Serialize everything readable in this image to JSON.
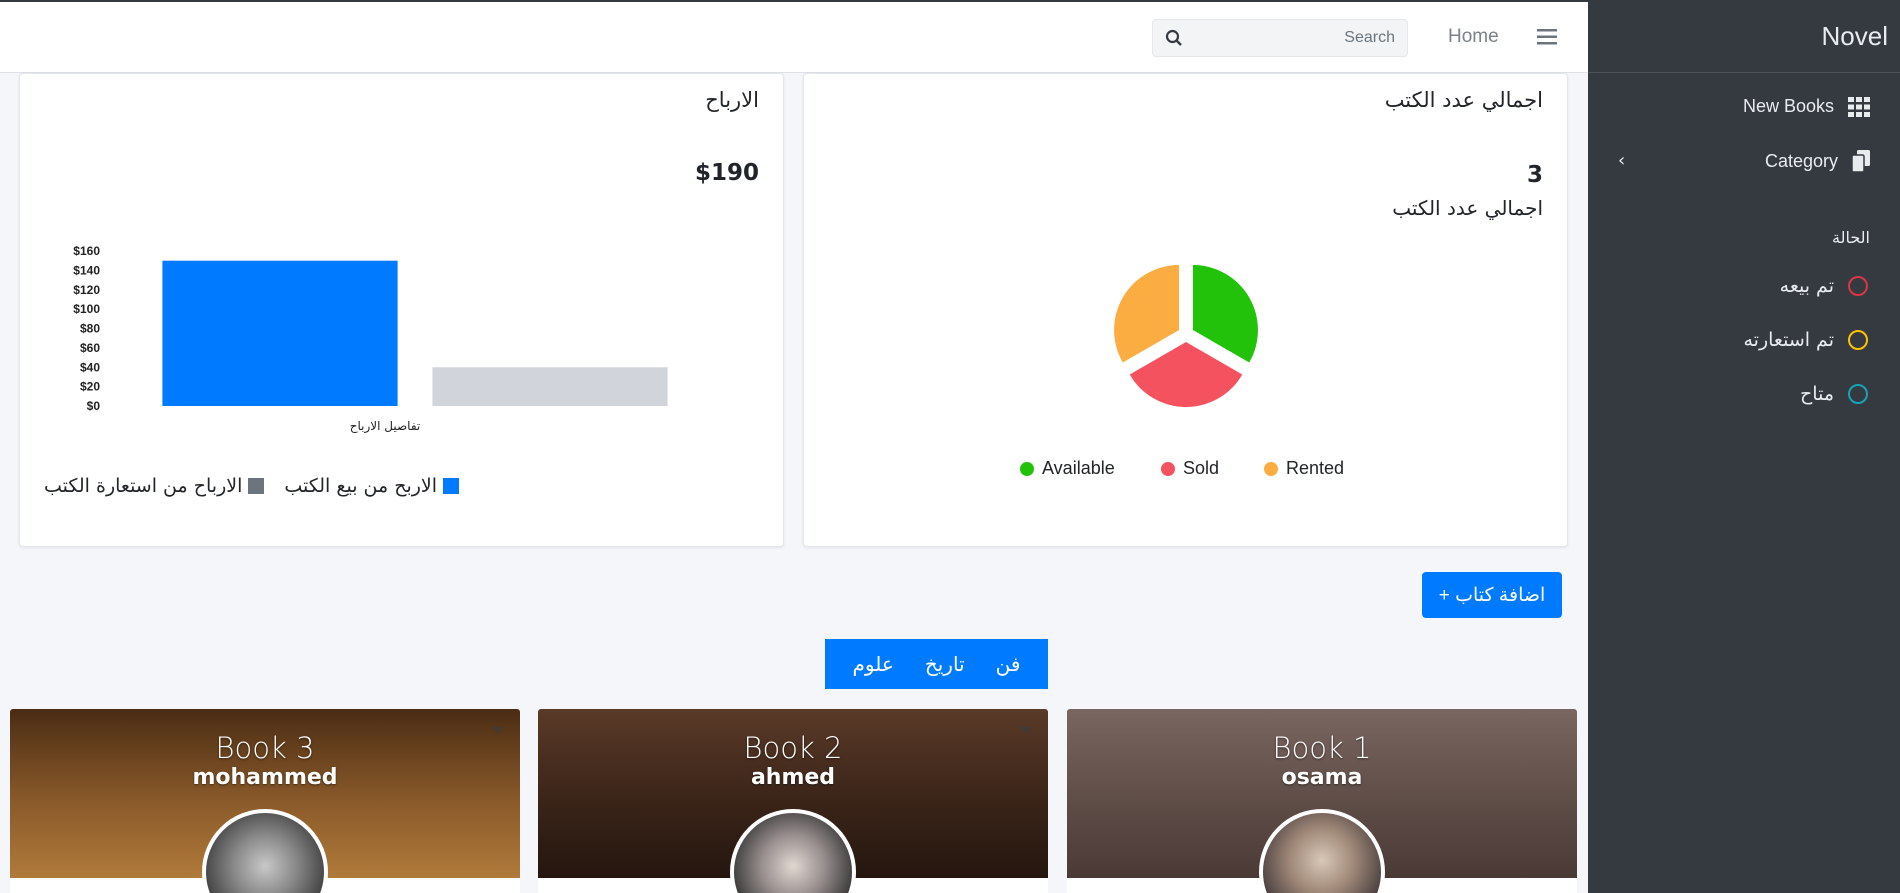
{
  "sidebar": {
    "brand": "Novel",
    "items": [
      {
        "label": "New Books",
        "icon": "grid-icon"
      },
      {
        "label": "Category",
        "icon": "copy-icon"
      }
    ],
    "status_heading": "الحالة",
    "statuses": [
      {
        "label": "تم بيعه",
        "color": "#dc3545"
      },
      {
        "label": "تم استعارته",
        "color": "#ffc107"
      },
      {
        "label": "متاح",
        "color": "#17a2b8"
      }
    ]
  },
  "topbar": {
    "search_placeholder": "Search",
    "home_label": "Home"
  },
  "books_card": {
    "title": "اجمالي عدد الكتب",
    "total": "3",
    "subtitle": "اجمالي عدد الكتب",
    "legend": [
      {
        "label": "Available",
        "color": "#22c20a"
      },
      {
        "label": "Sold",
        "color": "#f4525f"
      },
      {
        "label": "Rented",
        "color": "#fbad42"
      }
    ]
  },
  "profit_card": {
    "title": "الارباح",
    "total": "$190",
    "legend": [
      {
        "label": "الاربح من بيع الكتب",
        "color": "#007bff"
      },
      {
        "label": "الارباح من استعارة الكتب",
        "color": "#6c757d"
      }
    ]
  },
  "chart_data": [
    {
      "type": "pie",
      "labels": [
        "Available",
        "Sold",
        "Rented"
      ],
      "values": [
        1,
        1,
        1
      ],
      "colors": [
        "#22c20a",
        "#f4525f",
        "#fbad42"
      ],
      "legend_position": "bottom"
    },
    {
      "type": "bar",
      "categories": [
        "تفاصيل الارباح"
      ],
      "series": [
        {
          "name": "الاربح من بيع الكتب",
          "values": [
            150
          ],
          "color": "#007bff"
        },
        {
          "name": "الارباح من استعارة الكتب",
          "values": [
            40
          ],
          "color": "#d1d5db"
        }
      ],
      "yticks": [
        "$0",
        "$20",
        "$40",
        "$60",
        "$80",
        "$100",
        "$120",
        "$140",
        "$160"
      ],
      "ylim": [
        0,
        160
      ],
      "xlabel": "تفاصيل الارباح",
      "legend_position": "bottom-left"
    }
  ],
  "actions": {
    "add_book": "+ اضافة كتاب"
  },
  "categories": [
    "فن",
    "تاريخ",
    "علوم"
  ],
  "books": [
    {
      "title": "Book 1",
      "author": "osama",
      "bg": "#6a5650"
    },
    {
      "title": "Book 2",
      "author": "ahmed",
      "bg": "#3b2a22"
    },
    {
      "title": "Book 3",
      "author": "mohammed",
      "bg": "#5a3a1a"
    }
  ]
}
